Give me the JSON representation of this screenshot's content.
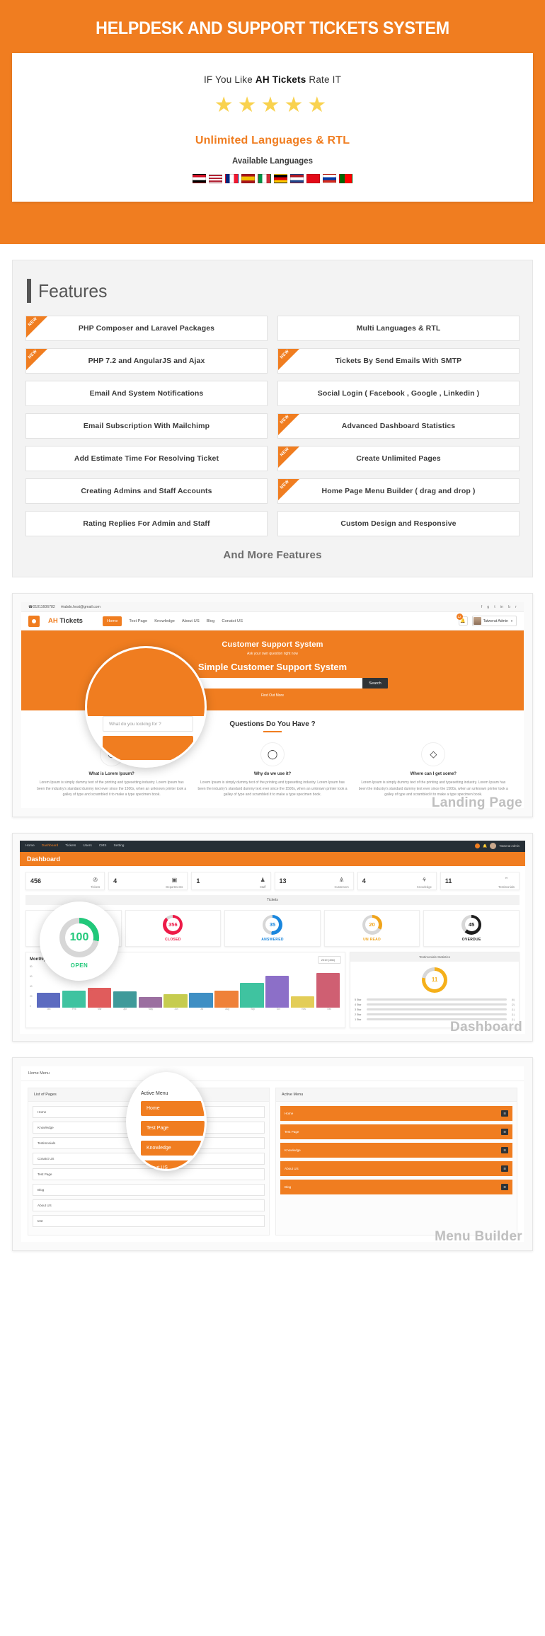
{
  "hero": {
    "title": "HELPDESK AND SUPPORT TICKETS SYSTEM",
    "rate_pre": "IF You Like ",
    "rate_brand": "AH Tickets",
    "rate_post": " Rate IT",
    "stars": 5,
    "star_glyph": "★",
    "languages_title": "Unlimited Languages & RTL",
    "languages_sub": "Available Languages",
    "flags": [
      {
        "name": "flag-egypt",
        "code": "EG"
      },
      {
        "name": "flag-usa",
        "code": "US"
      },
      {
        "name": "flag-france",
        "code": "FR"
      },
      {
        "name": "flag-spain",
        "code": "ES"
      },
      {
        "name": "flag-italy",
        "code": "IT"
      },
      {
        "name": "flag-germany",
        "code": "DE"
      },
      {
        "name": "flag-netherlands",
        "code": "NL"
      },
      {
        "name": "flag-turkey",
        "code": "TR"
      },
      {
        "name": "flag-russia",
        "code": "RU"
      },
      {
        "name": "flag-portugal",
        "code": "PT"
      }
    ]
  },
  "features": {
    "title": "Features",
    "new_badge": "NEW",
    "items": [
      {
        "label": "PHP Composer and Laravel Packages",
        "is_new": true
      },
      {
        "label": "Multi Languages & RTL",
        "is_new": false
      },
      {
        "label": "PHP 7.2 and AngularJS and Ajax",
        "is_new": true
      },
      {
        "label": "Tickets By Send Emails With SMTP",
        "is_new": true
      },
      {
        "label": "Email And System Notifications",
        "is_new": false
      },
      {
        "label": "Social Login ( Facebook , Google , Linkedin )",
        "is_new": false
      },
      {
        "label": "Email Subscription With Mailchimp",
        "is_new": false
      },
      {
        "label": "Advanced Dashboard Statistics",
        "is_new": true
      },
      {
        "label": "Add Estimate Time For Resolving Ticket",
        "is_new": false
      },
      {
        "label": "Create Unlimited Pages",
        "is_new": true
      },
      {
        "label": "Creating Admins and Staff Accounts",
        "is_new": false
      },
      {
        "label": "Home Page Menu Builder ( drag and drop )",
        "is_new": true
      },
      {
        "label": "Rating Replies For Admin and Staff",
        "is_new": false
      },
      {
        "label": "Custom Design and Responsive",
        "is_new": false
      }
    ],
    "footer": "And More Features"
  },
  "landing": {
    "label": "Landing Page",
    "topbar": {
      "phone": "01011606782",
      "email": "abdo.host@gmail.com",
      "social": [
        "f",
        "g",
        "t",
        "in",
        "b",
        "r"
      ]
    },
    "brand_a": "AH",
    "brand_b": "Tickets",
    "menu": [
      "Home",
      "Test Page",
      "Knowledge",
      "About US",
      "Blog",
      "Conatct US"
    ],
    "active_menu": "Home",
    "notifications": "12",
    "user": "Tatwerat Admin",
    "hero": {
      "line1": "Customer Support System",
      "line2": "Ask your own question right now",
      "line3": "Simple Customer Support System",
      "search_placeholder": "",
      "search_button": "Search",
      "find_text": "Find Out More"
    },
    "faq_title": "Questions Do You Have ?",
    "cards": [
      {
        "icon": "lifebuoy-icon",
        "glyph": "℗",
        "title": "What is Lorem Ipsum?",
        "body": "Lorem Ipsum is simply dummy text of the printing and typesetting industry. Lorem Ipsum has been the industry's standard dummy text ever since the 1500s, when an unknown printer took a galley of type and scrambled it to make a type specimen book."
      },
      {
        "icon": "chat-icon",
        "glyph": "◯",
        "title": "Why do we use it?",
        "body": "Lorem Ipsum is simply dummy text of the printing and typesetting industry. Lorem Ipsum has been the industry's standard dummy text ever since the 1500s, when an unknown printer took a galley of type and scrambled it to make a type specimen book."
      },
      {
        "icon": "diamond-icon",
        "glyph": "◇",
        "title": "Where can I get some?",
        "body": "Lorem Ipsum is simply dummy text of the printing and typesetting industry. Lorem Ipsum has been the industry's standard dummy text ever since the 1500s, when an unknown printer took a galley of type and scrambled it to make a type specimen book."
      }
    ],
    "magnifier": {
      "search_placeholder": "What do you looking for ?"
    }
  },
  "dashboard": {
    "label": "Dashboard",
    "nav": [
      "Home",
      "Dashboard",
      "Tickets",
      "Users",
      "CMS",
      "Setting"
    ],
    "nav_active": "Dashboard",
    "user": "Tatwerat Admin",
    "page_title": "Dashboard",
    "stats": [
      {
        "value": "456",
        "label": "Tickets",
        "icon": "tickets-icon",
        "glyph": "✇"
      },
      {
        "value": "4",
        "label": "Departments",
        "icon": "departments-icon",
        "glyph": "▣"
      },
      {
        "value": "1",
        "label": "Staff",
        "icon": "staff-icon",
        "glyph": "♟"
      },
      {
        "value": "13",
        "label": "Customers",
        "icon": "customers-icon",
        "glyph": "Ѧ"
      },
      {
        "value": "4",
        "label": "Knowledge",
        "icon": "knowledge-icon",
        "glyph": "⚘"
      },
      {
        "value": "11",
        "label": "Testimonials",
        "icon": "testimonials-icon",
        "glyph": "”"
      }
    ],
    "tickets_section": "Tickets",
    "donuts": [
      {
        "value": "100",
        "label": "OPEN",
        "color": "#21c87a",
        "percent": 28
      },
      {
        "value": "356",
        "label": "CLOSED",
        "color": "#ed1b48",
        "percent": 88
      },
      {
        "value": "35",
        "label": "ANSWERED",
        "color": "#1a87de",
        "percent": 52
      },
      {
        "value": "20",
        "label": "UN READ",
        "color": "#f0a41b",
        "percent": 33
      },
      {
        "value": "45",
        "label": "OVERDUE",
        "color": "#1d1d1d",
        "percent": 62
      }
    ],
    "testimonials_panel": {
      "title": "Testimonials Statistics",
      "total": "11",
      "color": "#f5b01a",
      "percent": 78,
      "rows": [
        {
          "label": "5 Star",
          "count": "(6)",
          "percent": 62
        },
        {
          "label": "4 Star",
          "count": "(2)",
          "percent": 21
        },
        {
          "label": "3 Star",
          "count": "(1)",
          "percent": 7
        },
        {
          "label": "2 Star",
          "count": "(1)",
          "percent": 7
        },
        {
          "label": "1 Star",
          "count": "(1)",
          "percent": 7
        }
      ]
    }
  },
  "chart_data": {
    "type": "bar",
    "title": "Monthly Tickets IN 2019",
    "year_select": "2019 (456)",
    "xlabel": "",
    "ylabel": "",
    "ylim": [
      0,
      80
    ],
    "yticks": [
      "0",
      "20",
      "40",
      "60",
      "80"
    ],
    "grid": true,
    "legend": "none",
    "categories": [
      "Jan",
      "Feb",
      "Mar",
      "Apr",
      "May",
      "Jun",
      "Jul",
      "Aug",
      "Sep",
      "Oct",
      "Nov",
      "Dec"
    ],
    "values": [
      29,
      33,
      40,
      32,
      21,
      27,
      30,
      33,
      50,
      64,
      22,
      70
    ],
    "colors": [
      "#5c6bc0",
      "#3fc3a0",
      "#e05c5c",
      "#3f9a9a",
      "#9b6fa0",
      "#c6cc4f",
      "#3f8fc4",
      "#ef8139",
      "#3fc3a0",
      "#8c6fc8",
      "#e3cd58",
      "#cf5f72"
    ]
  },
  "menu_builder": {
    "label": "Menu Builder",
    "head": "Home Menu",
    "pages_title": "List of Pages",
    "active_title": "Active Menu",
    "pages": [
      "Home",
      "Knowledge",
      "Testimonials",
      "Conatct US",
      "Test Page",
      "Blog",
      "About US",
      "test"
    ],
    "active_items": [
      "Home",
      "Test Page",
      "Knowledge",
      "About US",
      "Blog"
    ],
    "handle_glyph": "☰"
  },
  "colors": {
    "accent": "#f07d20",
    "dark": "#262f36",
    "star": "#f9d24f"
  }
}
